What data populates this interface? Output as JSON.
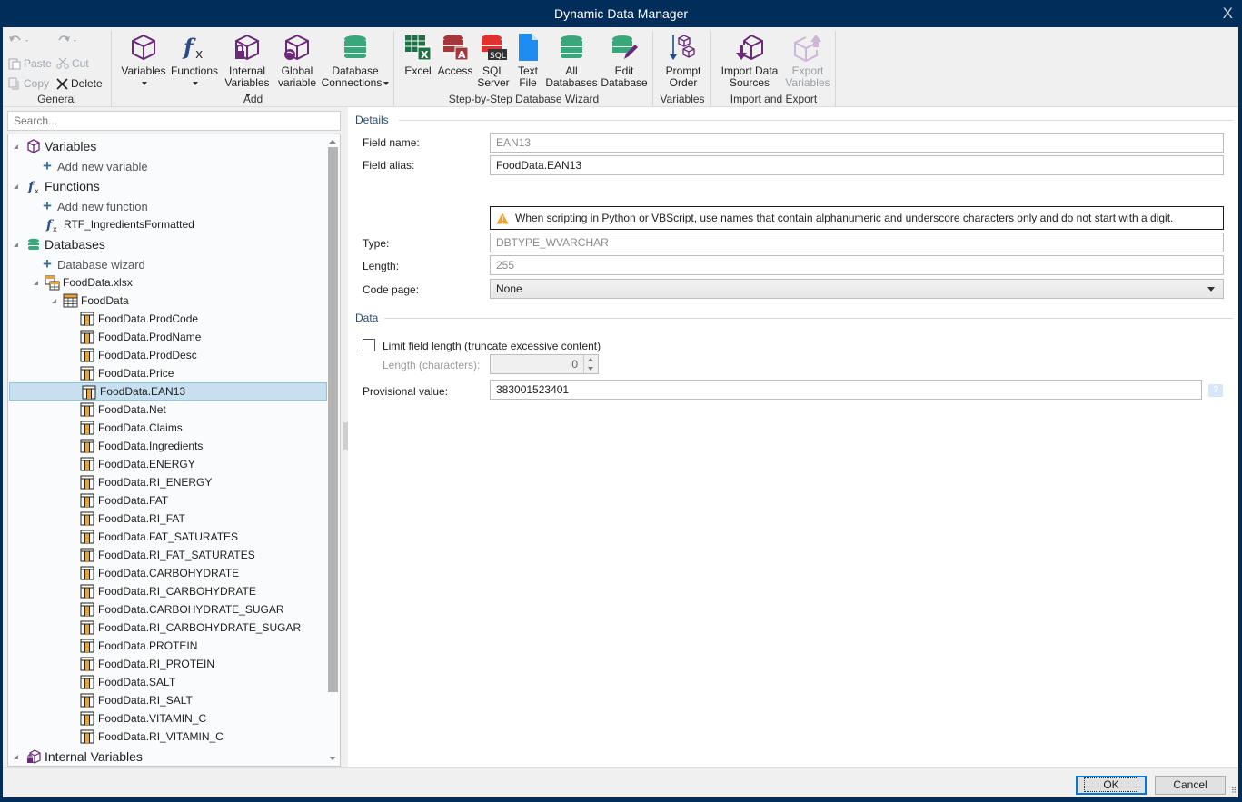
{
  "window": {
    "title": "Dynamic Data Manager",
    "close_label": "X"
  },
  "ribbon": {
    "general": {
      "label": "General",
      "undo_icon": "undo-icon",
      "redo_icon": "redo-icon",
      "paste": "Paste",
      "cut": "Cut",
      "copy": "Copy",
      "delete": "Delete"
    },
    "add": {
      "label": "Add",
      "variables": "Variables",
      "functions": "Functions",
      "internal_variables_1": "Internal",
      "internal_variables_2": "Variables",
      "global_variable_1": "Global",
      "global_variable_2": "variable",
      "database_connections_1": "Database",
      "database_connections_2": "Connections"
    },
    "wizard": {
      "label": "Step-by-Step Database Wizard",
      "excel": "Excel",
      "access": "Access",
      "sql_1": "SQL",
      "sql_2": "Server",
      "text_1": "Text",
      "text_2": "File",
      "all_1": "All",
      "all_2": "Databases",
      "edit_1": "Edit",
      "edit_2": "Database"
    },
    "variables": {
      "label": "Variables",
      "prompt_1": "Prompt",
      "prompt_2": "Order"
    },
    "import_export": {
      "label": "Import and Export",
      "import_1": "Import Data",
      "import_2": "Sources",
      "export_1": "Export",
      "export_2": "Variables"
    }
  },
  "search": {
    "placeholder": "Search..."
  },
  "tree": {
    "variables": "Variables",
    "add_variable": "Add new variable",
    "functions": "Functions",
    "add_function": "Add new function",
    "function_item": "RTF_IngredientsFormatted",
    "databases": "Databases",
    "database_wizard": "Database wizard",
    "db_file": "FoodData.xlsx",
    "db_table": "FoodData",
    "fields": [
      "FoodData.ProdCode",
      "FoodData.ProdName",
      "FoodData.ProdDesc",
      "FoodData.Price",
      "FoodData.EAN13",
      "FoodData.Net",
      "FoodData.Claims",
      "FoodData.Ingredients",
      "FoodData.ENERGY",
      "FoodData.RI_ENERGY",
      "FoodData.FAT",
      "FoodData.RI_FAT",
      "FoodData.FAT_SATURATES",
      "FoodData.RI_FAT_SATURATES",
      "FoodData.CARBOHYDRATE",
      "FoodData.RI_CARBOHYDRATE",
      "FoodData.CARBOHYDRATE_SUGAR",
      "FoodData.RI_CARBOHYDRATE_SUGAR",
      "FoodData.PROTEIN",
      "FoodData.RI_PROTEIN",
      "FoodData.SALT",
      "FoodData.RI_SALT",
      "FoodData.VITAMIN_C",
      "FoodData.RI_VITAMIN_C"
    ],
    "selected_field": "FoodData.EAN13",
    "internal_variables": "Internal Variables"
  },
  "details": {
    "section": "Details",
    "field_name_label": "Field name:",
    "field_name": "EAN13",
    "field_alias_label": "Field alias:",
    "field_alias": "FoodData.EAN13",
    "warning": "When scripting in Python or VBScript, use names that contain alphanumeric and underscore characters only and do not start with a digit.",
    "type_label": "Type:",
    "type": "DBTYPE_WVARCHAR",
    "length_label": "Length:",
    "length": "255",
    "code_page_label": "Code page:",
    "code_page": "None"
  },
  "data": {
    "section": "Data",
    "limit_label": "Limit field length (truncate excessive content)",
    "limit_checked": false,
    "length_chars_label": "Length (characters):",
    "length_chars": "0",
    "provisional_label": "Provisional value:",
    "provisional_value": "383001523401",
    "help_glyph": "?"
  },
  "footer": {
    "ok": "OK",
    "cancel": "Cancel"
  },
  "colors": {
    "titlebar": "#002d5a",
    "selection": "#c7e0ef",
    "accent": "#0078d7",
    "warning": "#f0a030"
  }
}
